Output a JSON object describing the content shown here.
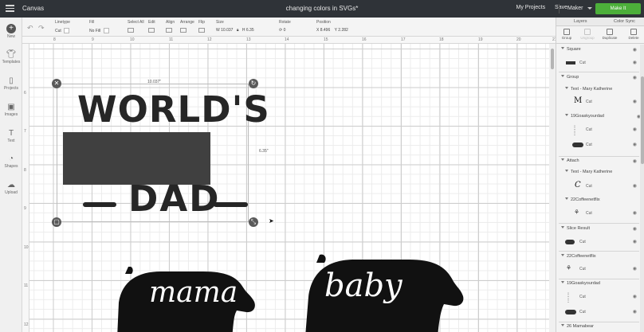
{
  "titlebar": {
    "app_name": "Canvas",
    "document_title": "changing colors in SVGs*",
    "my_projects": "My Projects",
    "save": "Save",
    "machine": "Maker",
    "make_it": "Make It"
  },
  "toolbar": {
    "linetype_label": "Linetype",
    "linetype_value": "Cut",
    "fill_label": "Fill",
    "fill_value": "No Fill",
    "select_all_label": "Select All",
    "edit_label": "Edit",
    "align_label": "Align",
    "arrange_label": "Arrange",
    "flip_label": "Flip",
    "size_label": "Size",
    "size_w_prefix": "W",
    "size_w": "10.037",
    "size_h_prefix": "H",
    "size_h": "6.35",
    "rotate_label": "Rotate",
    "rotate_value": "0",
    "position_label": "Position",
    "pos_x_prefix": "X",
    "pos_x": "8.496",
    "pos_y_prefix": "Y",
    "pos_y": "2.282"
  },
  "leftbar": {
    "items": [
      {
        "icon": "plus-icon",
        "label": "New"
      },
      {
        "icon": "shirt-icon",
        "label": "Templates"
      },
      {
        "icon": "projects-icon",
        "label": "Projects"
      },
      {
        "icon": "image-icon",
        "label": "Images"
      },
      {
        "icon": "text-icon",
        "label": "Text"
      },
      {
        "icon": "shapes-icon",
        "label": "Shapes"
      },
      {
        "icon": "upload-icon",
        "label": "Upload"
      }
    ]
  },
  "rulers": {
    "top": [
      "8",
      "9",
      "10",
      "11",
      "12",
      "13",
      "14",
      "15",
      "16",
      "17",
      "18",
      "19",
      "20",
      "21"
    ],
    "left": [
      "6",
      "7",
      "8",
      "9",
      "10",
      "11",
      "12"
    ]
  },
  "canvas": {
    "width_dimension": "10.037\"",
    "height_dimension": "6.35\"",
    "worlds_text": "WORLD'S",
    "dad_text": "DAD",
    "mama_text": "mama",
    "baby_text": "baby"
  },
  "panel": {
    "tabs": [
      "Layers",
      "Color Sync"
    ],
    "actions": [
      {
        "label": "Group",
        "enabled": true
      },
      {
        "label": "Ungroup",
        "enabled": false
      },
      {
        "label": "Duplicate",
        "enabled": true
      },
      {
        "label": "Delete",
        "enabled": true
      }
    ],
    "layers": {
      "square": "Square",
      "square_cut": "Cut",
      "group": "Group",
      "text_mary_1": "Text - Mary Katherine",
      "cut_m": "Cut",
      "goaskyourdad_1": "19Goaskyourdad",
      "cut_a": "Cut",
      "cut_b": "Cut",
      "attach": "Attach",
      "text_mary_2": "Text - Mary Katherine",
      "cut_c": "Cut",
      "coffee_1": "22Coffeenetflix",
      "cut_d": "Cut",
      "slice_result": "Slice Result",
      "cut_e": "Cut",
      "coffee_2": "22Coffeenetflix",
      "cut_f": "Cut",
      "goaskyourdad_2": "19Goaskyourdad",
      "cut_g": "Cut",
      "cut_h": "Cut",
      "mamabear": "26 Mamabear"
    },
    "thumbs": {
      "m_glyph": "M",
      "c_glyph": "C"
    }
  },
  "colors": {
    "titlebar": "#2f3338",
    "make_it": "#4caf3a",
    "design_fill": "#262626",
    "rect_fill": "#404040"
  }
}
